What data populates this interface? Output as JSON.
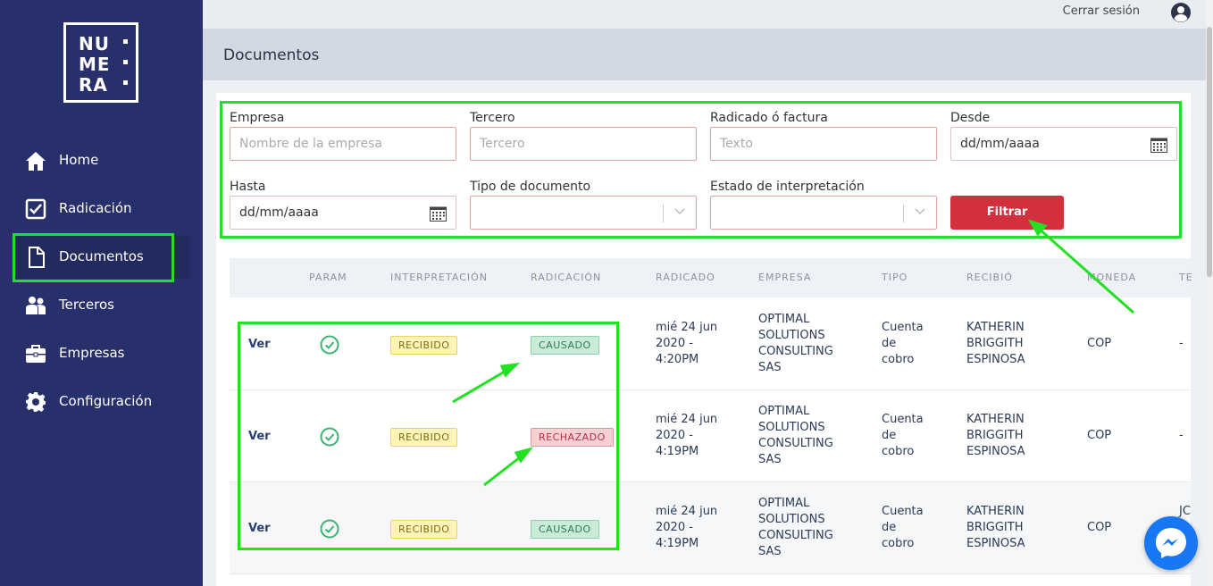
{
  "brand": {
    "logo_lines": [
      "NU",
      "ME",
      "RA"
    ]
  },
  "sidebar": {
    "items": [
      {
        "label": "Home",
        "icon": "home-icon"
      },
      {
        "label": "Radicación",
        "icon": "checkbox-icon"
      },
      {
        "label": "Documentos",
        "icon": "document-icon",
        "active": true
      },
      {
        "label": "Terceros",
        "icon": "users-icon"
      },
      {
        "label": "Empresas",
        "icon": "briefcase-icon"
      },
      {
        "label": "Configuración",
        "icon": "gear-icon"
      }
    ]
  },
  "topbar": {
    "logout_label": "Cerrar sesión",
    "user_icon": "user-circle-icon"
  },
  "page": {
    "title": "Documentos"
  },
  "filters": {
    "empresa": {
      "label": "Empresa",
      "placeholder": "Nombre de la empresa"
    },
    "tercero": {
      "label": "Tercero",
      "placeholder": "Tercero"
    },
    "radicado": {
      "label": "Radicado ó factura",
      "placeholder": "Texto"
    },
    "desde": {
      "label": "Desde",
      "value": "dd/mm/aaaa"
    },
    "hasta": {
      "label": "Hasta",
      "value": "dd/mm/aaaa"
    },
    "tipo": {
      "label": "Tipo de documento",
      "value": ""
    },
    "estado": {
      "label": "Estado de interpretación",
      "value": ""
    },
    "submit_label": "Filtrar"
  },
  "table": {
    "headers": [
      "PARAM",
      "INTERPRETACIÓN",
      "RADICACIÓN",
      "RADICADO",
      "EMPRESA",
      "TIPO",
      "RECIBIÓ",
      "MONEDA",
      "TE"
    ],
    "rows": [
      {
        "action": "Ver",
        "interpretacion": "RECIBIDO",
        "radicacion": "CAUSADO",
        "radicacion_status": "green",
        "radicado": [
          "mié 24 jun",
          "2020 -",
          "4:20PM"
        ],
        "empresa": [
          "OPTIMAL",
          "SOLUTIONS",
          "CONSULTING",
          "SAS"
        ],
        "tipo": [
          "Cuenta",
          "de",
          "cobro"
        ],
        "recibio": [
          "KATHERIN",
          "BRIGGITH",
          "ESPINOSA"
        ],
        "moneda": "COP",
        "te": "-"
      },
      {
        "action": "Ver",
        "interpretacion": "RECIBIDO",
        "radicacion": "RECHAZADO",
        "radicacion_status": "red",
        "radicado": [
          "mié 24 jun",
          "2020 -",
          "4:19PM"
        ],
        "empresa": [
          "OPTIMAL",
          "SOLUTIONS",
          "CONSULTING",
          "SAS"
        ],
        "tipo": [
          "Cuenta",
          "de",
          "cobro"
        ],
        "recibio": [
          "KATHERIN",
          "BRIGGITH",
          "ESPINOSA"
        ],
        "moneda": "COP",
        "te": "-"
      },
      {
        "action": "Ver",
        "interpretacion": "RECIBIDO",
        "radicacion": "CAUSADO",
        "radicacion_status": "green",
        "radicado": [
          "mié 24 jun",
          "2020 -",
          "4:19PM"
        ],
        "empresa": [
          "OPTIMAL",
          "SOLUTIONS",
          "CONSULTING",
          "SAS"
        ],
        "tipo": [
          "Cuenta",
          "de",
          "cobro"
        ],
        "recibio": [
          "KATHERIN",
          "BRIGGITH",
          "ESPINOSA"
        ],
        "moneda": "COP",
        "te": "JC"
      }
    ]
  },
  "colors": {
    "sidebar": "#28306b",
    "accent_red": "#d3303e",
    "highlight": "#22e022"
  }
}
